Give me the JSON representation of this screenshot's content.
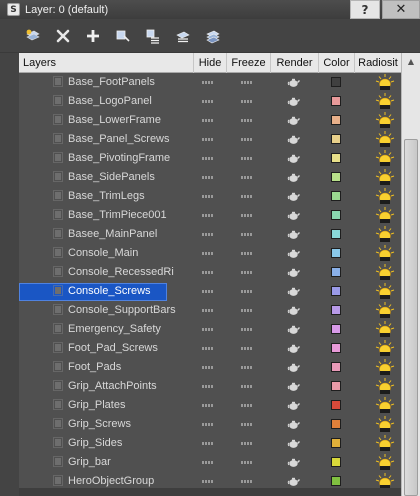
{
  "window": {
    "title": "Layer: 0 (default)",
    "help_label": "?",
    "close_label": "✕"
  },
  "toolbar": {
    "tools": [
      {
        "name": "create-layer-icon"
      },
      {
        "name": "delete-layer-icon"
      },
      {
        "name": "add-to-layer-icon"
      },
      {
        "name": "select-objects-icon"
      },
      {
        "name": "highlight-selected-icon"
      },
      {
        "name": "set-current-layer-icon"
      },
      {
        "name": "hide-all-icon"
      }
    ]
  },
  "header": {
    "layers": "Layers",
    "hide": "Hide",
    "freeze": "Freeze",
    "render": "Render",
    "color": "Color",
    "radiosity": "Radiosit"
  },
  "scroll": {
    "up_arrow": "▲"
  },
  "rows": [
    {
      "name": "Base_FootPanels",
      "color": "#404040"
    },
    {
      "name": "Base_LogoPanel",
      "color": "#e89a9a"
    },
    {
      "name": "Base_LowerFrame",
      "color": "#e8b08a"
    },
    {
      "name": "Base_Panel_Screws",
      "color": "#e8d08a"
    },
    {
      "name": "Base_PivotingFrame",
      "color": "#e8e08a"
    },
    {
      "name": "Base_SidePanels",
      "color": "#b8e08a"
    },
    {
      "name": "Base_TrimLegs",
      "color": "#9ad890"
    },
    {
      "name": "Base_TrimPiece001",
      "color": "#8ad8b0"
    },
    {
      "name": "Basee_MainPanel",
      "color": "#8ad8d8"
    },
    {
      "name": "Console_Main",
      "color": "#8ac8e8"
    },
    {
      "name": "Console_RecessedRi",
      "color": "#8ab0e8"
    },
    {
      "name": "Console_Screws",
      "color": "#9a9ae8",
      "selected": true
    },
    {
      "name": "Console_SupportBars",
      "color": "#b89ae8"
    },
    {
      "name": "Emergency_Safety",
      "color": "#d89ae8"
    },
    {
      "name": "Foot_Pad_Screws",
      "color": "#e89ad8"
    },
    {
      "name": "Foot_Pads",
      "color": "#e89ab8"
    },
    {
      "name": "Grip_AttachPoints",
      "color": "#e89aa8"
    },
    {
      "name": "Grip_Plates",
      "color": "#d84a3a"
    },
    {
      "name": "Grip_Screws",
      "color": "#e0803a"
    },
    {
      "name": "Grip_Sides",
      "color": "#e0b03a"
    },
    {
      "name": "Grip_bar",
      "color": "#d8d83a"
    },
    {
      "name": "HeroObjectGroup",
      "color": "#80c040"
    }
  ]
}
